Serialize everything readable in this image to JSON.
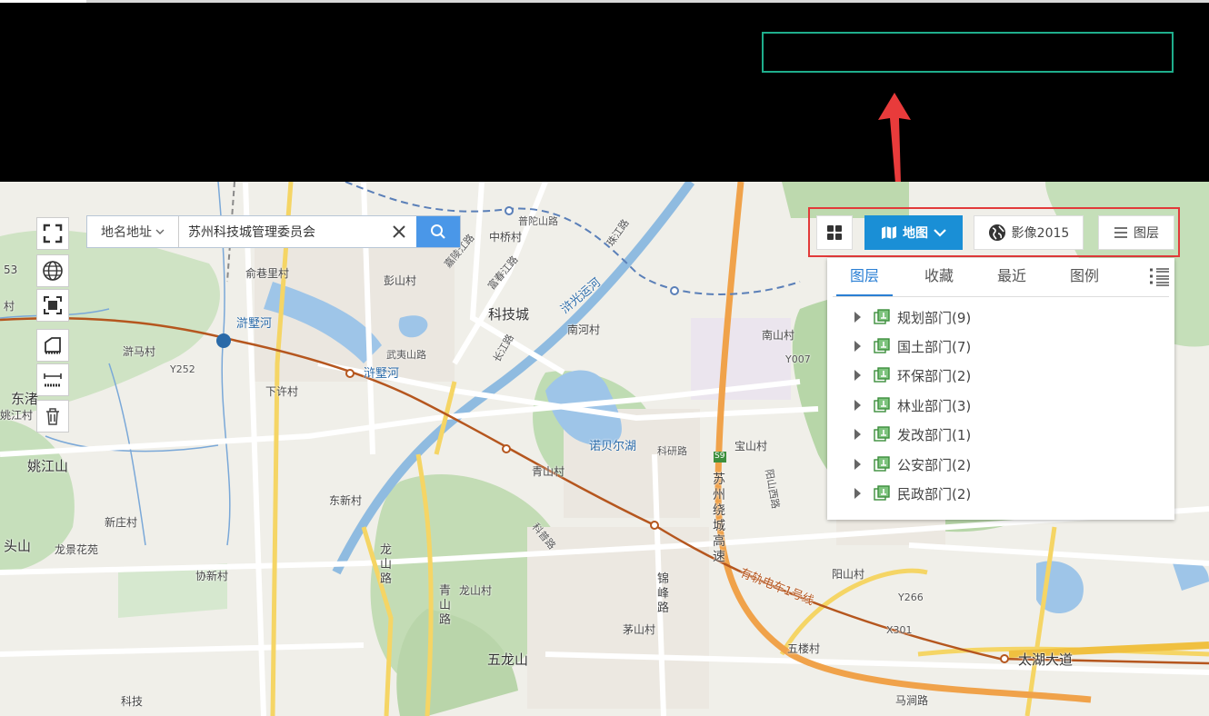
{
  "search": {
    "type_label": "地名地址",
    "value": "苏州科技城管理委员会"
  },
  "toolbar": {
    "map_label": "地图",
    "image_label": "影像2015",
    "layers_label": "图层"
  },
  "panel": {
    "tabs": [
      {
        "label": "图层"
      },
      {
        "label": "收藏"
      },
      {
        "label": "最近"
      },
      {
        "label": "图例"
      }
    ],
    "items": [
      {
        "label": "规划部门(9)"
      },
      {
        "label": "国土部门(7)"
      },
      {
        "label": "环保部门(2)"
      },
      {
        "label": "林业部门(3)"
      },
      {
        "label": "发改部门(1)"
      },
      {
        "label": "公安部门(2)"
      },
      {
        "label": "民政部门(2)"
      }
    ]
  },
  "map": {
    "labels": {
      "l1": "53",
      "l2": "村",
      "l3": "俞巷里村",
      "l4": "滸墅河",
      "l5": "滸马村",
      "l6": "Y252",
      "l7": "浒墅河",
      "l8": "下许村",
      "l9": "东渚",
      "l10": "姚江村",
      "l11": "姚江山",
      "l12": "东新村",
      "l13": "新庄村",
      "l14": "头山",
      "l15": "龙景花苑",
      "l16": "协新村",
      "l17": "彭山村",
      "l18": "中桥村",
      "l19": "普陀山路",
      "l20": "科技城",
      "l21": "南河村",
      "l22": "武夷山路",
      "l23": "青山村",
      "l24": "诺贝尔湖",
      "l25": "科研路",
      "l26": "宝山村",
      "l27": "南山村",
      "l28": "Y007",
      "l29": "苏州绕城高速",
      "l30": "S9",
      "l31": "阳山村",
      "l32": "Y266",
      "l33": "X301",
      "l34": "太湖大道",
      "l35": "五楼村",
      "l36": "马涧路",
      "l37": "龙山路",
      "l38": "青山路",
      "l39": "龙山村",
      "l40": "五龙山",
      "l41": "锦峰路",
      "l42": "茅山村",
      "l43": "有轨电车1号线",
      "l44": "科技",
      "l45": "浒光运河",
      "l46": "富春江路",
      "l47": "嘉陵江路",
      "l48": "珠江路",
      "l49": "科普路",
      "l50": "长江路",
      "l51": "阳山西路"
    }
  }
}
